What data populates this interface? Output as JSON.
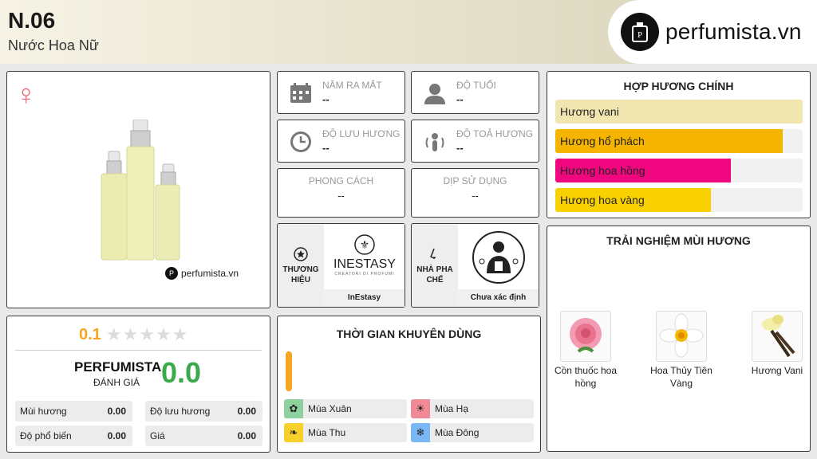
{
  "header": {
    "title": "N.06",
    "subtitle": "Nước Hoa Nữ",
    "brand": "perfumista.vn"
  },
  "product": {
    "gender_icon": "female-icon",
    "watermark": "perfumista.vn"
  },
  "info": {
    "year_label": "NĂM RA MẮT",
    "year_value": "--",
    "age_label": "ĐỘ TUỔI",
    "age_value": "--",
    "longevity_label": "ĐỘ LƯU HƯƠNG",
    "longevity_value": "--",
    "sillage_label": "ĐỘ TOẢ HƯƠNG",
    "sillage_value": "--",
    "style_label": "PHONG CÁCH",
    "style_value": "--",
    "occasion_label": "DỊP SỬ DỤNG",
    "occasion_value": "--"
  },
  "brand_tile": {
    "label": "THƯƠNG HIỆU",
    "name": "InEstasy",
    "logo_text": "INESTASY",
    "logo_tagline": "CREATORI DI PROFUMI"
  },
  "perfumer_tile": {
    "label": "NHÀ PHA CHẾ",
    "name": "Chưa xác định"
  },
  "accords": {
    "title": "HỢP HƯƠNG CHÍNH",
    "items": [
      {
        "name": "Hương vani",
        "level": 100,
        "color": "#f2e6b0"
      },
      {
        "name": "Hương hổ phách",
        "level": 92,
        "color": "#f4b400"
      },
      {
        "name": "Hương hoa hồng",
        "level": 71,
        "color": "#f0077f"
      },
      {
        "name": "Hương hoa vàng",
        "level": 63,
        "color": "#f9d000"
      }
    ]
  },
  "notes": {
    "title": "TRẢI NGHIỆM MÙI HƯƠNG",
    "items": [
      {
        "name": "Cồn thuốc hoa hồng"
      },
      {
        "name": "Hoa Thủy Tiên Vàng"
      },
      {
        "name": "Hương Vani"
      }
    ]
  },
  "rating": {
    "score": "0.1",
    "pf_title": "PERFUMISTA",
    "pf_sub": "ĐÁNH GIÁ",
    "pf_score": "0.0",
    "metrics": [
      {
        "label": "Mùi hương",
        "value": "0.00"
      },
      {
        "label": "Độ lưu hương",
        "value": "0.00"
      },
      {
        "label": "Độ phổ biến",
        "value": "0.00"
      },
      {
        "label": "Giá",
        "value": "0.00"
      }
    ]
  },
  "seasons": {
    "title": "THỜI GIAN KHUYÊN DÙNG",
    "items": [
      {
        "name": "Mùa Xuân",
        "color": "#8fd19e",
        "icon": "spring-icon"
      },
      {
        "name": "Mùa Hạ",
        "color": "#f08a97",
        "icon": "sun-icon"
      },
      {
        "name": "Mùa Thu",
        "color": "#f7d02c",
        "icon": "leaf-icon"
      },
      {
        "name": "Mùa Đông",
        "color": "#7ab8f5",
        "icon": "snowflake-icon"
      }
    ]
  }
}
